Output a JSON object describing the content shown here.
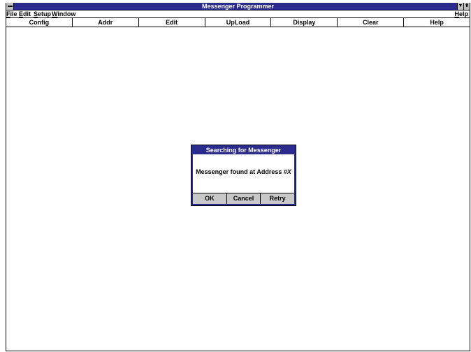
{
  "window": {
    "title": "Messenger Programmer"
  },
  "menubar": {
    "items": [
      {
        "label": "File",
        "underline": "F"
      },
      {
        "label": "Edit",
        "underline": "E"
      },
      {
        "label": "Setup",
        "underline": "S"
      },
      {
        "label": "Window",
        "underline": "W"
      }
    ],
    "help": "Help"
  },
  "toolbar": {
    "buttons": [
      "Config",
      "Addr",
      "Edit",
      "UpLoad",
      "Display",
      "Clear",
      "Help"
    ]
  },
  "dialog": {
    "title": "Searching for Messenger",
    "message": "Messenger found at Address #",
    "message_value": "X",
    "buttons": [
      "OK",
      "Cancel",
      "Retry"
    ]
  },
  "icons": {
    "system_menu": "system-menu-icon",
    "minimize": "minimize-arrow-icon",
    "restore": "restore-arrows-icon"
  },
  "colors": {
    "title_bar": "#2b2b8e",
    "button_face": "#c8c8c8"
  }
}
